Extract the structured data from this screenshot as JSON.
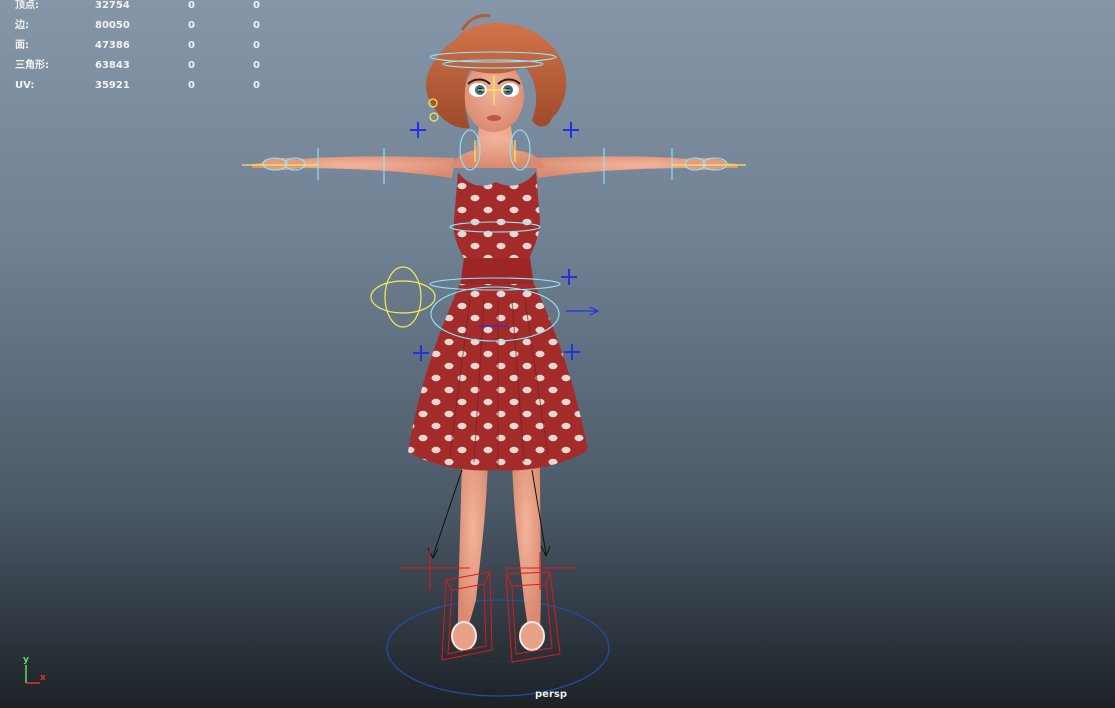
{
  "hud": {
    "rows": [
      {
        "label": "顶点:",
        "v1": "32754",
        "v2": "0",
        "v3": "0"
      },
      {
        "label": "边:",
        "v1": "80050",
        "v2": "0",
        "v3": "0"
      },
      {
        "label": "面:",
        "v1": "47386",
        "v2": "0",
        "v3": "0"
      },
      {
        "label": "三角形:",
        "v1": "63843",
        "v2": "0",
        "v3": "0"
      },
      {
        "label": "UV:",
        "v1": "35921",
        "v2": "0",
        "v3": "0"
      }
    ]
  },
  "viewport": {
    "camera": "persp",
    "axis": {
      "y": "y",
      "x": "x"
    }
  },
  "colors": {
    "bg_top": "#8596a8",
    "bg_bottom": "#1c2126",
    "rig_cyan": "#8fe6ff",
    "rig_yellow": "#f2ee50",
    "rig_blue": "#2233dd",
    "rig_red": "#e01818",
    "dress_red": "#a8302e",
    "skin": "#eba58c",
    "hair": "#c0603a"
  },
  "icons": {
    "axis": "axis-gizmo-icon"
  }
}
